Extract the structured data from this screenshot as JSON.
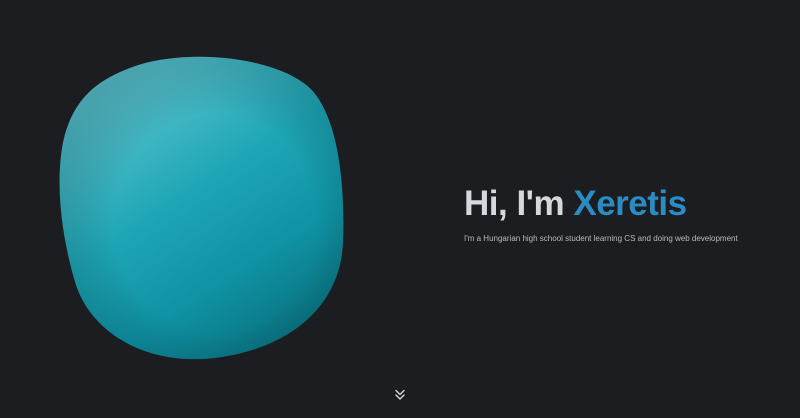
{
  "hero": {
    "greeting": "Hi, I'm ",
    "name": "Xeretis",
    "subtitle": "I'm a Hungarian high school student learning CS and doing web development"
  },
  "colors": {
    "background": "#1b1d20",
    "title": "#d5d8dc",
    "accent": "#2b8cc4",
    "blob_light": "#5fc6d0",
    "blob_mid": "#1aa3b4",
    "blob_dark": "#0d7c8c"
  },
  "icons": {
    "scroll_down": "double-chevron-down-icon"
  }
}
